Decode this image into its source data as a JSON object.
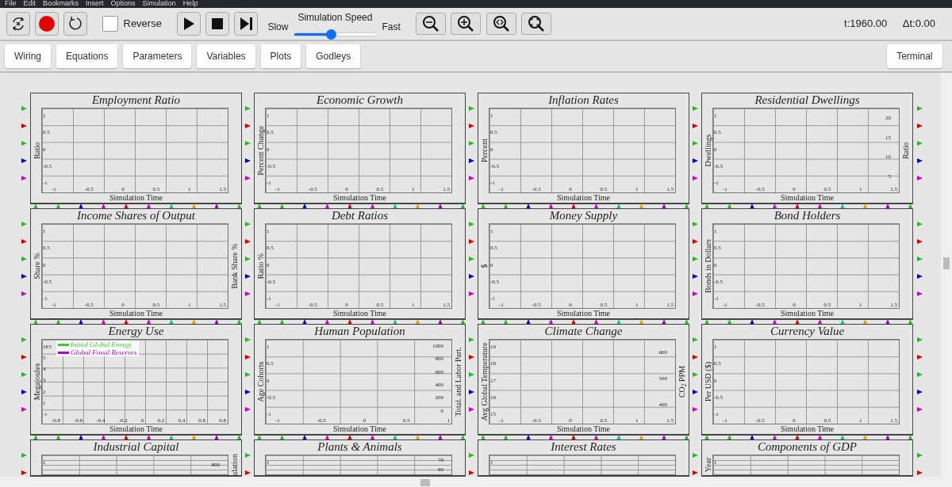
{
  "menu": [
    "File",
    "Edit",
    "Bookmarks",
    "Insert",
    "Options",
    "Simulation",
    "Help"
  ],
  "toolbar": {
    "reverse": {
      "label": "Reverse",
      "checked": false
    },
    "speed": {
      "title": "Simulation Speed",
      "min_label": "Slow",
      "max_label": "Fast",
      "level": 0.45
    },
    "time": "t:1960.00",
    "step": "Δt:0.00"
  },
  "tabs": [
    {
      "label": "Wiring",
      "selected": false
    },
    {
      "label": "Equations",
      "selected": false
    },
    {
      "label": "Parameters",
      "selected": false
    },
    {
      "label": "Variables",
      "selected": false
    },
    {
      "label": "Plots",
      "selected": false
    },
    {
      "label": "Godleys",
      "selected": false
    }
  ],
  "right_tabs": [
    {
      "label": "Terminal",
      "selected": false
    }
  ],
  "canvas": {
    "bottom_ports": [
      {
        "color": "#22bb22"
      },
      {
        "color": "#22bb22"
      },
      {
        "color": "#0000cc"
      },
      {
        "color": "#cc00cc"
      },
      {
        "color": "#dd0000"
      },
      {
        "color": "#cc00cc"
      },
      {
        "color": "#11bbaa"
      },
      {
        "color": "#ee9900"
      },
      {
        "color": "#9900cc"
      },
      {
        "color": "#22bb22"
      }
    ],
    "side_ports": [
      {
        "color": "#22bb22"
      },
      {
        "color": "#dd0000"
      },
      {
        "color": "#22bb22"
      },
      {
        "color": "#0000cc"
      },
      {
        "color": "#cc00cc"
      }
    ],
    "plots": [
      {
        "title": "Employment Ratio",
        "ylabel": "Ratio",
        "yticks": [
          "1",
          "0.5",
          "0",
          "-0.5",
          "-1"
        ],
        "xticks": [
          "-1",
          "-0.5",
          "0",
          "0.5",
          "1",
          "1.5"
        ],
        "xlabel": "Simulation Time"
      },
      {
        "title": "Economic Growth",
        "ylabel": "Percent Change",
        "yticks": [
          "1",
          "0.5",
          "0",
          "-0.5",
          "-1"
        ],
        "xticks": [
          "-1",
          "-0.5",
          "0",
          "0.5",
          "1",
          "1.5"
        ],
        "xlabel": "Simulation Time"
      },
      {
        "title": "Inflation Rates",
        "ylabel": "Percent",
        "yticks": [
          "1",
          "0.5",
          "0",
          "-0.5",
          "-1"
        ],
        "xticks": [
          "-1",
          "-0.5",
          "0",
          "0.5",
          "1",
          "1.5"
        ],
        "xlabel": "Simulation Time"
      },
      {
        "title": "Residential Dwellings",
        "ylabel": "Dwellings",
        "yticks": [
          "1",
          "0.5",
          "0",
          "-0.5",
          "-1"
        ],
        "xticks": [
          "-1",
          "-0.5",
          "0",
          "0.5",
          "1",
          "1.5"
        ],
        "xlabel": "Simulation Time",
        "right_ticks": [
          "20",
          "15",
          "10",
          "5"
        ],
        "right_label": "Ratio"
      },
      {
        "title": "Income Shares of Output",
        "ylabel": "Share %",
        "yticks": [
          "1",
          "0.5",
          "0",
          "-0.5",
          "-1"
        ],
        "xticks": [
          "-1",
          "-0.5",
          "0",
          "0.5",
          "1",
          "1.5"
        ],
        "xlabel": "Simulation Time",
        "right_label": "Bank Share %"
      },
      {
        "title": "Debt Ratios",
        "ylabel": "Ratio %",
        "yticks": [
          "1",
          "0.5",
          "0",
          "-0.5",
          "-1"
        ],
        "xticks": [
          "-1",
          "-0.5",
          "0",
          "0.5",
          "1",
          "1.5"
        ],
        "xlabel": "Simulation Time"
      },
      {
        "title": "Money Supply",
        "ylabel": "$",
        "yticks": [
          "1",
          "0.5",
          "0",
          "-0.5",
          "-1"
        ],
        "xticks": [
          "-1",
          "-0.5",
          "0",
          "0.5",
          "1",
          "1.5"
        ],
        "xlabel": "Simulation Time"
      },
      {
        "title": "Bond Holders",
        "ylabel": "Bonds in Dollars",
        "yticks": [
          "1",
          "0.5",
          "0",
          "-0.5",
          "-1"
        ],
        "xticks": [
          "-1",
          "-0.5",
          "0",
          "0.5",
          "1",
          "1.5"
        ],
        "xlabel": "Simulation Time"
      },
      {
        "title": "Energy Use",
        "ylabel": "Megajoules",
        "multiplier": "1E5",
        "yticks": [
          "5",
          "4",
          "3",
          "2",
          "1",
          "-1"
        ],
        "xticks": [
          "-0.8",
          "-0.6",
          "-0.4",
          "-0.2",
          "0",
          "0.2",
          "0.4",
          "0.6",
          "0.8"
        ],
        "xlabel": "Simulation Time",
        "legend": [
          {
            "label": "Initial Global Energy",
            "color": "#33cc33"
          },
          {
            "label": "Global Fossil Reserves",
            "color": "#aa00cc"
          }
        ]
      },
      {
        "title": "Human Population",
        "ylabel": "Age Cohorts",
        "yticks": [
          "1",
          "0.5",
          "0",
          "-0.5",
          "-1"
        ],
        "xticks": [
          "-1",
          "-0.5",
          "0",
          "0.5",
          "1"
        ],
        "xlabel": "Simulation Time",
        "right_ticks": [
          "1000",
          "800",
          "600",
          "400",
          "200",
          "0"
        ],
        "right_label": "Total. and Labor Part."
      },
      {
        "title": "Climate Change",
        "ylabel": "Avg Global Temperature",
        "yticks": [
          "19",
          "18",
          "17",
          "16",
          "15"
        ],
        "xticks": [
          "-1",
          "-0.5",
          "0",
          "0.5",
          "1",
          "1.5"
        ],
        "xlabel": "Simulation Time",
        "right_ticks": [
          "600",
          "500",
          "400"
        ],
        "right_label": "CO$_{2}$ PPM"
      },
      {
        "title": "Currency Value",
        "ylabel": "Per USD ($)",
        "yticks": [
          "1",
          "0.5",
          "0",
          "-0.5",
          "-1"
        ],
        "xticks": [
          "-1",
          "-0.5",
          "0",
          "0.5",
          "1",
          "1.5"
        ],
        "xlabel": "Simulation Time"
      },
      {
        "title": "Industrial Capital",
        "yticks": [
          "1"
        ],
        "right_ticks": [
          "800"
        ],
        "right_label": "ulation"
      },
      {
        "title": "Plants & Animals",
        "yticks": [
          "1"
        ],
        "right_ticks": [
          "70",
          "60"
        ]
      },
      {
        "title": "Interest Rates",
        "yticks": [
          "1"
        ]
      },
      {
        "title": "Components of GDP",
        "ylabel": "Year",
        "yticks": [
          "1"
        ]
      }
    ]
  }
}
